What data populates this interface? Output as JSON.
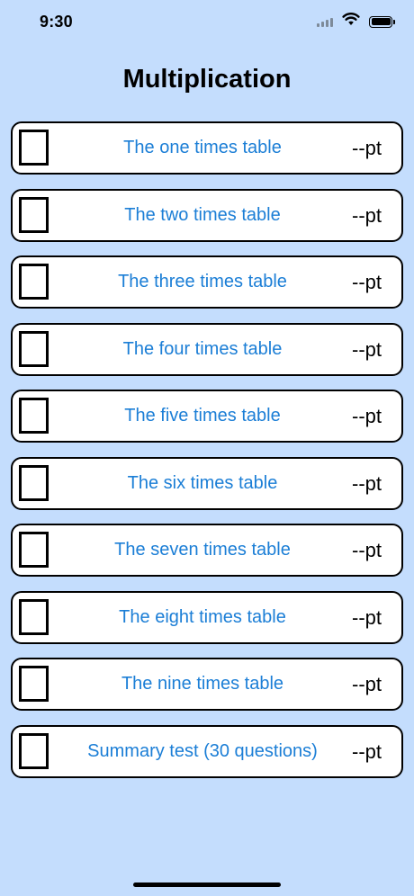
{
  "status_bar": {
    "time": "9:30",
    "icons": [
      "signal-icon",
      "wifi-icon",
      "battery-icon"
    ]
  },
  "title": "Multiplication",
  "rows": [
    {
      "label": "The one times table",
      "score": "--pt",
      "checked": false
    },
    {
      "label": "The two times table",
      "score": "--pt",
      "checked": false
    },
    {
      "label": "The three times table",
      "score": "--pt",
      "checked": false
    },
    {
      "label": "The four times table",
      "score": "--pt",
      "checked": false
    },
    {
      "label": "The five times table",
      "score": "--pt",
      "checked": false
    },
    {
      "label": "The six times table",
      "score": "--pt",
      "checked": false
    },
    {
      "label": "The seven times table",
      "score": "--pt",
      "checked": false
    },
    {
      "label": "The eight times table",
      "score": "--pt",
      "checked": false
    },
    {
      "label": "The nine times table",
      "score": "--pt",
      "checked": false
    },
    {
      "label": "Summary test (30 questions)",
      "score": "--pt",
      "checked": false
    }
  ],
  "colors": {
    "background": "#c4ddfd",
    "link": "#1b7ed6",
    "row_background": "#ffffff",
    "border": "#000000"
  }
}
